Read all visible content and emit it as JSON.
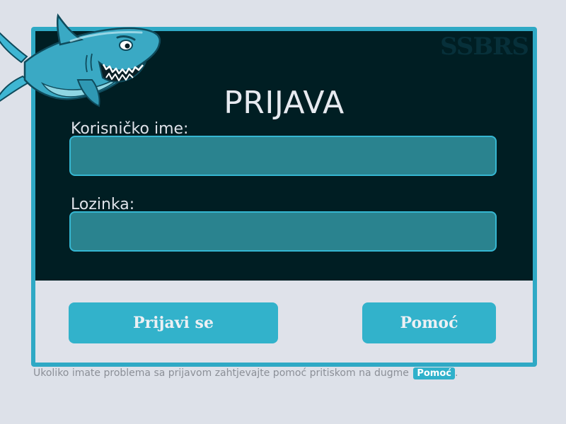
{
  "brand": {
    "text": "SSBRS"
  },
  "form": {
    "title": "PRIJAVA",
    "username_label": "Korisničko ime:",
    "username_value": "",
    "password_label": "Lozinka:",
    "password_value": ""
  },
  "buttons": {
    "login_label": "Prijavi se",
    "help_label": "Pomoć"
  },
  "footer": {
    "note": "Ukoliko imate problema sa prijavom zahtjevajte pomoć pritiskom na dugme",
    "badge": "Pomoć",
    "end": "."
  },
  "colors": {
    "accent": "#2fa9c5",
    "dark_panel": "#001e23",
    "input_fill": "#2a838f",
    "page_bg": "#dde1e9"
  },
  "mascot": {
    "icon": "shark-icon"
  }
}
